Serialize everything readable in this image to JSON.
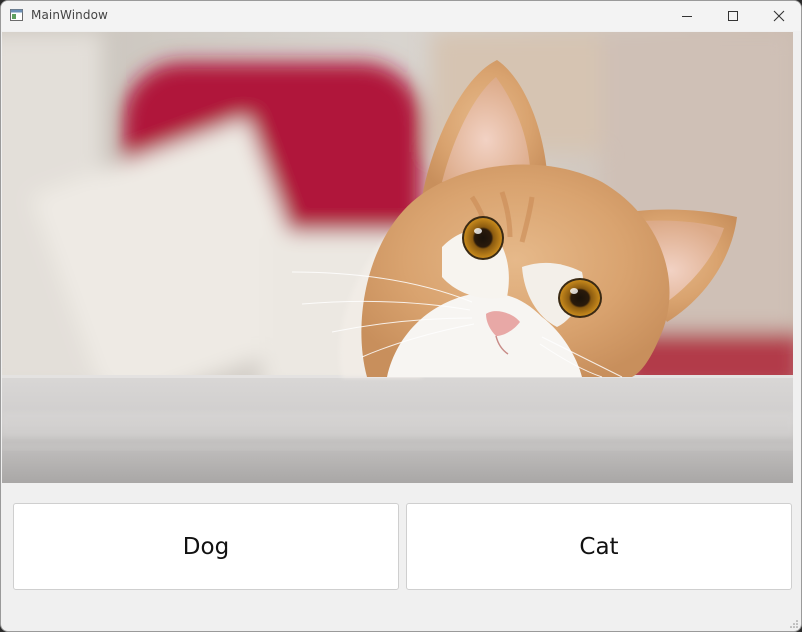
{
  "window": {
    "title": "MainWindow",
    "app_icon": "window-app-icon",
    "controls": {
      "minimize_icon": "minimize-icon",
      "maximize_icon": "maximize-icon",
      "close_icon": "close-icon"
    }
  },
  "image": {
    "subject": "cat"
  },
  "buttons": {
    "dog_label": "Dog",
    "cat_label": "Cat"
  },
  "colors": {
    "window_bg": "#f0f0f0",
    "button_bg": "#ffffff",
    "button_border": "#cfcfcf"
  }
}
